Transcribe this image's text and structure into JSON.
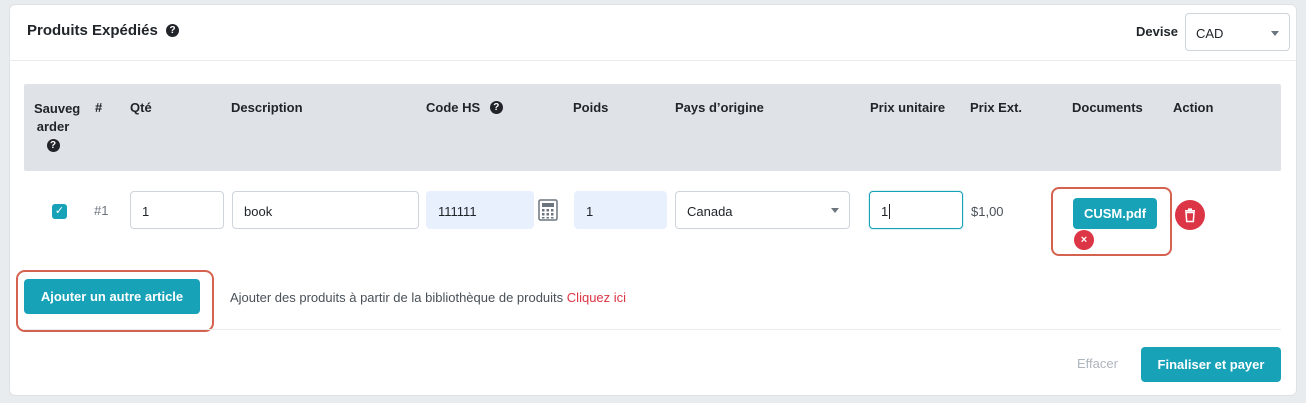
{
  "header": {
    "title": "Produits Expédiés",
    "help_glyph": "?",
    "currency_label": "Devise",
    "currency_value": "CAD"
  },
  "table": {
    "columns": {
      "save": "Sauvegarder",
      "number": "#",
      "qty": "Qté",
      "description": "Description",
      "hs_code": "Code HS",
      "weight": "Poids",
      "origin": "Pays d’origine",
      "unit_price": "Prix unitaire",
      "ext_price": "Prix Ext.",
      "documents": "Documents",
      "action": "Action"
    },
    "rows": [
      {
        "checked": true,
        "check_glyph": "✓",
        "number": "#1",
        "qty": "1",
        "description": "book",
        "hs_code": "111111",
        "weight": "1",
        "origin": "Canada",
        "unit_price": "1",
        "ext_price": "$1,00",
        "document": "CUSM.pdf",
        "remove_glyph": "×"
      }
    ]
  },
  "actions": {
    "add_item": "Ajouter un autre article",
    "library_text": "Ajouter des produits à partir de la bibliothèque de produits",
    "library_link": "Cliquez ici",
    "clear": "Effacer",
    "finalize": "Finaliser et payer"
  },
  "colors": {
    "primary": "#17a2b8",
    "danger": "#dc3545",
    "highlight": "#d4624e",
    "header_bg": "#dfe3e7"
  }
}
